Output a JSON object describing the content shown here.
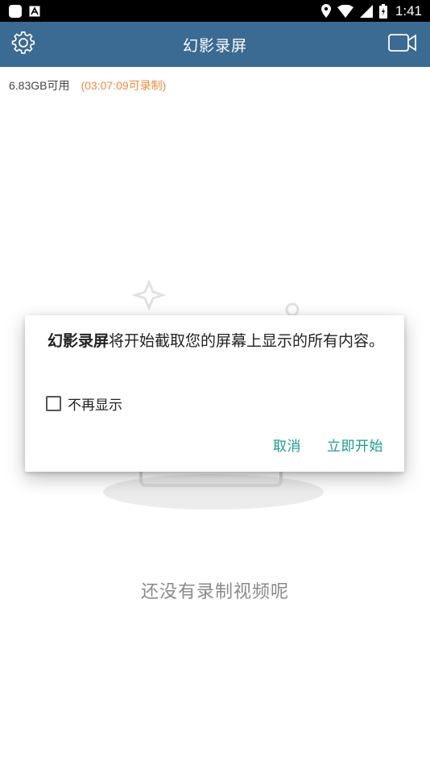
{
  "status_bar": {
    "time": "1:41",
    "icons": [
      "notification-app-icon",
      "a-text-icon",
      "location-icon",
      "wifi-icon",
      "signal-icon",
      "battery-icon"
    ]
  },
  "app_bar": {
    "title": "幻影录屏",
    "left_icon": "settings-gear-icon",
    "right_icon": "video-camera-icon",
    "color": "#3b6a93"
  },
  "storage": {
    "available": "6.83GB可用",
    "remaining_record": "(03:07:09可录制)",
    "remaining_color": "#f08b3e"
  },
  "empty_state": {
    "text": "还没有录制视频呢"
  },
  "dialog": {
    "app_name": "幻影录屏",
    "message": "将开始截取您的屏幕上显示的所有内容。",
    "checkbox_label": "不再显示",
    "checkbox_checked": false,
    "cancel_label": "取消",
    "start_label": "立即开始",
    "accent": "#1a9c8f"
  }
}
